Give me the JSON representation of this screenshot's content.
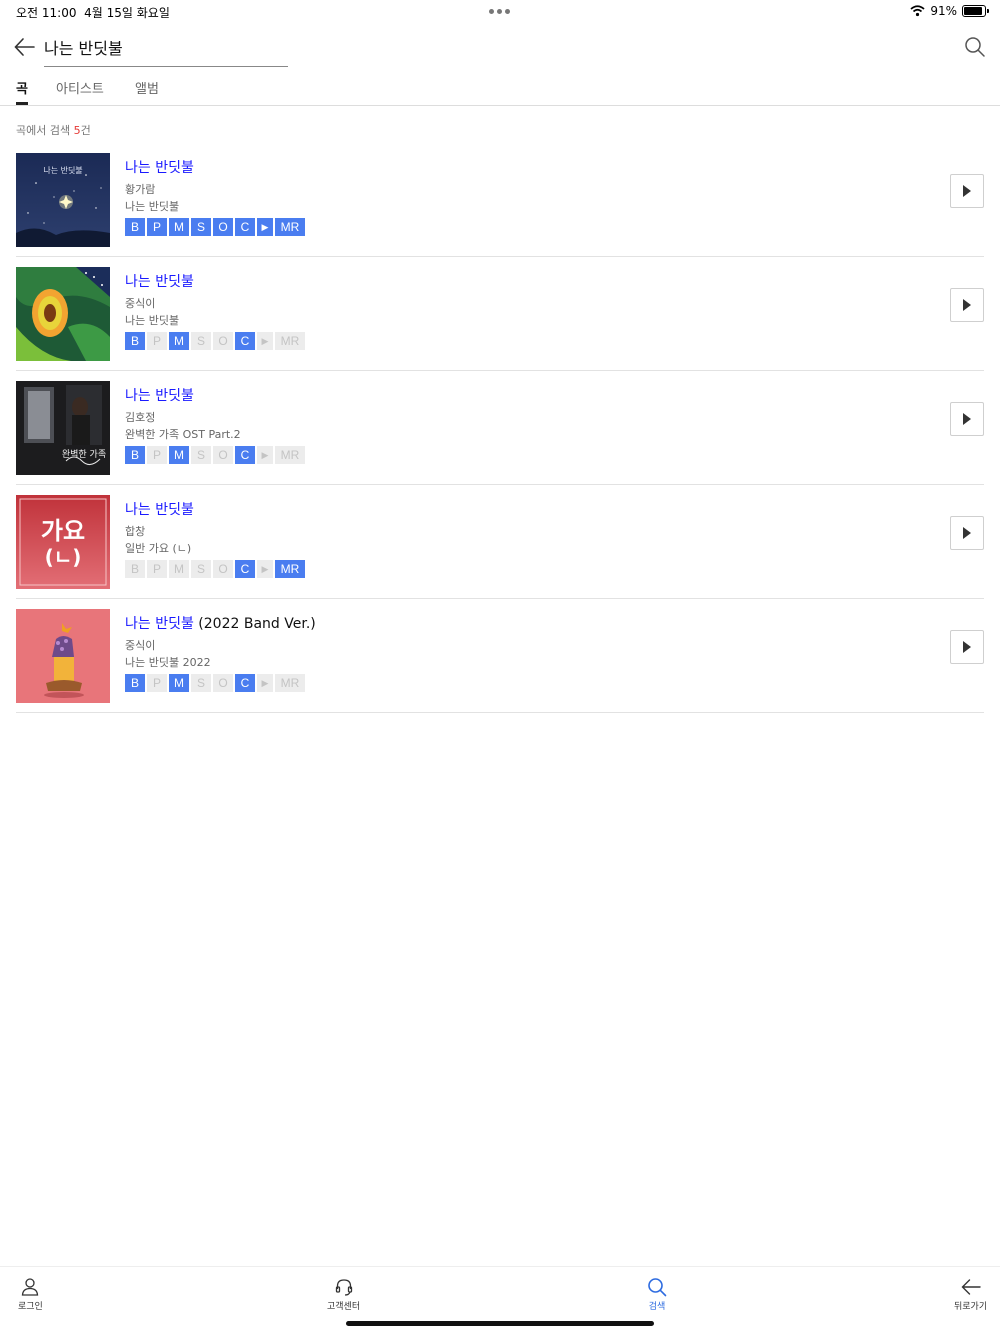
{
  "status": {
    "time": "오전 11:00",
    "date": "4월 15일 화요일",
    "battery": "91%",
    "battery_level": 0.91
  },
  "search": {
    "query": "나는 반딧불"
  },
  "tabs": [
    {
      "label": "곡",
      "active": true
    },
    {
      "label": "아티스트",
      "active": false
    },
    {
      "label": "앨범",
      "active": false
    }
  ],
  "result_summary": {
    "prefix": "곡에서 검색 ",
    "count": "5",
    "suffix": "건"
  },
  "results": [
    {
      "title": "나는 반딧불",
      "title_extra": "",
      "artist": "황가람",
      "album": "나는 반딧불",
      "badges": [
        [
          "B",
          true
        ],
        [
          "P",
          true
        ],
        [
          "M",
          true
        ],
        [
          "S",
          true
        ],
        [
          "O",
          true
        ],
        [
          "C",
          true
        ],
        [
          "▶",
          true
        ],
        [
          "MR",
          true
        ]
      ]
    },
    {
      "title": "나는 반딧불",
      "title_extra": "",
      "artist": "중식이",
      "album": "나는 반딧불",
      "badges": [
        [
          "B",
          true
        ],
        [
          "P",
          false
        ],
        [
          "M",
          true
        ],
        [
          "S",
          false
        ],
        [
          "O",
          false
        ],
        [
          "C",
          true
        ],
        [
          "▶",
          false
        ],
        [
          "MR",
          false
        ]
      ]
    },
    {
      "title": "나는 반딧불",
      "title_extra": "",
      "artist": "김호정",
      "album": "완벽한 가족 OST Part.2",
      "badges": [
        [
          "B",
          true
        ],
        [
          "P",
          false
        ],
        [
          "M",
          true
        ],
        [
          "S",
          false
        ],
        [
          "O",
          false
        ],
        [
          "C",
          true
        ],
        [
          "▶",
          false
        ],
        [
          "MR",
          false
        ]
      ]
    },
    {
      "title": "나는 반딧불",
      "title_extra": "",
      "artist": "합창",
      "album": "일반 가요 (ㄴ)",
      "badges": [
        [
          "B",
          false
        ],
        [
          "P",
          false
        ],
        [
          "M",
          false
        ],
        [
          "S",
          false
        ],
        [
          "O",
          false
        ],
        [
          "C",
          true
        ],
        [
          "▶",
          false
        ],
        [
          "MR",
          true
        ]
      ]
    },
    {
      "title": "나는 반딧불",
      "title_extra": " (2022 Band Ver.)",
      "artist": "중식이",
      "album": "나는 반딧불 2022",
      "badges": [
        [
          "B",
          true
        ],
        [
          "P",
          false
        ],
        [
          "M",
          true
        ],
        [
          "S",
          false
        ],
        [
          "O",
          false
        ],
        [
          "C",
          true
        ],
        [
          "▶",
          false
        ],
        [
          "MR",
          false
        ]
      ]
    }
  ],
  "covers": [
    {
      "type": "night-sky",
      "text": "나는 반딧불"
    },
    {
      "type": "green-fruit"
    },
    {
      "type": "photo-dark",
      "text": "완벽한 가족"
    },
    {
      "type": "genre-pink",
      "line1": "가요",
      "line2": "(ㄴ)"
    },
    {
      "type": "pink-illustration"
    }
  ],
  "nav": [
    {
      "label": "로그인",
      "icon": "user-icon",
      "active": false
    },
    {
      "label": "고객센터",
      "icon": "headset-icon",
      "active": false
    },
    {
      "label": "검색",
      "icon": "search-icon",
      "active": true
    },
    {
      "label": "뒤로가기",
      "icon": "back-arrow-icon",
      "active": false
    }
  ],
  "colors": {
    "accent": "#4a7df0",
    "title_link": "#1a1aff",
    "count": "#e53935",
    "active_nav": "#2d6be0"
  }
}
